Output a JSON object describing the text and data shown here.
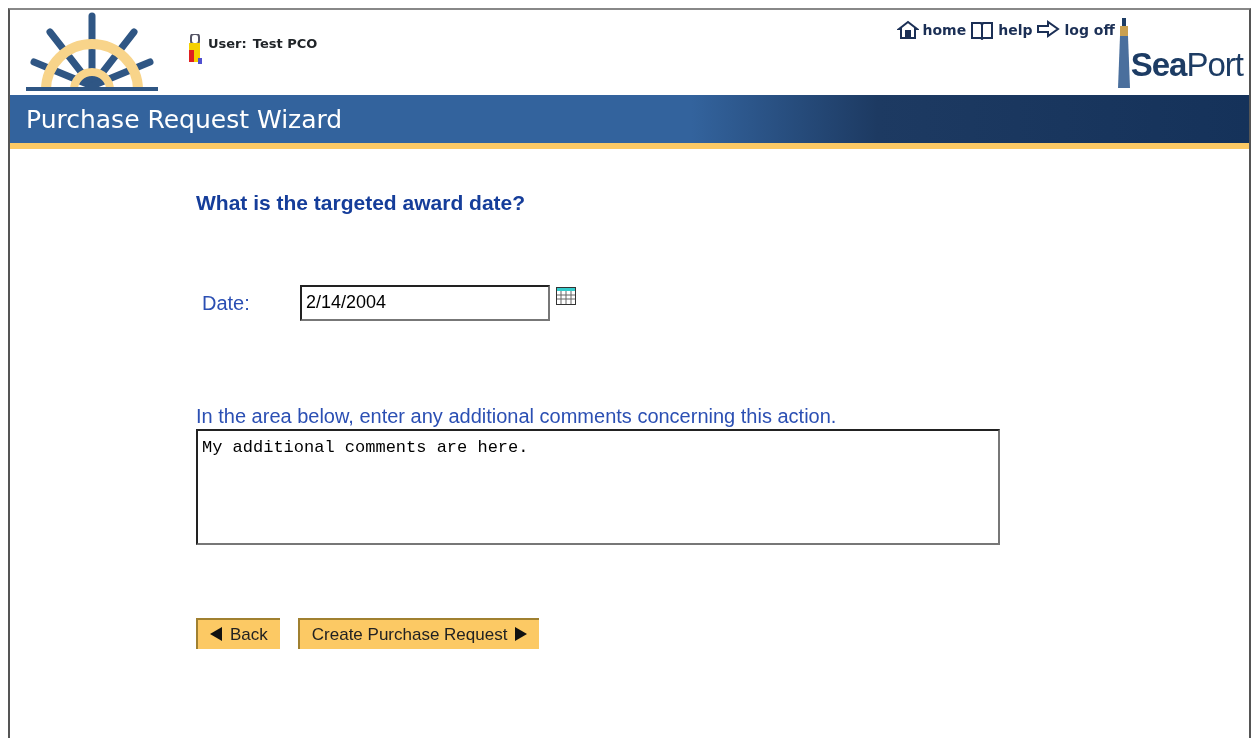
{
  "header": {
    "user_label": "User:",
    "user_name": "Test PCO",
    "links": [
      {
        "kind": "home",
        "label": "home"
      },
      {
        "kind": "help",
        "label": "help"
      },
      {
        "kind": "logoff",
        "label": "log off"
      }
    ],
    "brand": "**Sea**Port"
  },
  "title_bar": {
    "title": "Purchase Request Wizard"
  },
  "question": "What is the targeted award date?",
  "date_field": {
    "label": "Date:",
    "value": "2/14/2004"
  },
  "comments": {
    "label": "In the area below, enter any additional comments concerning this action.",
    "value": "My additional comments are here."
  },
  "buttons": [
    {
      "kind": "back",
      "label": "Back"
    },
    {
      "kind": "next",
      "label": "Create Purchase Request"
    }
  ]
}
